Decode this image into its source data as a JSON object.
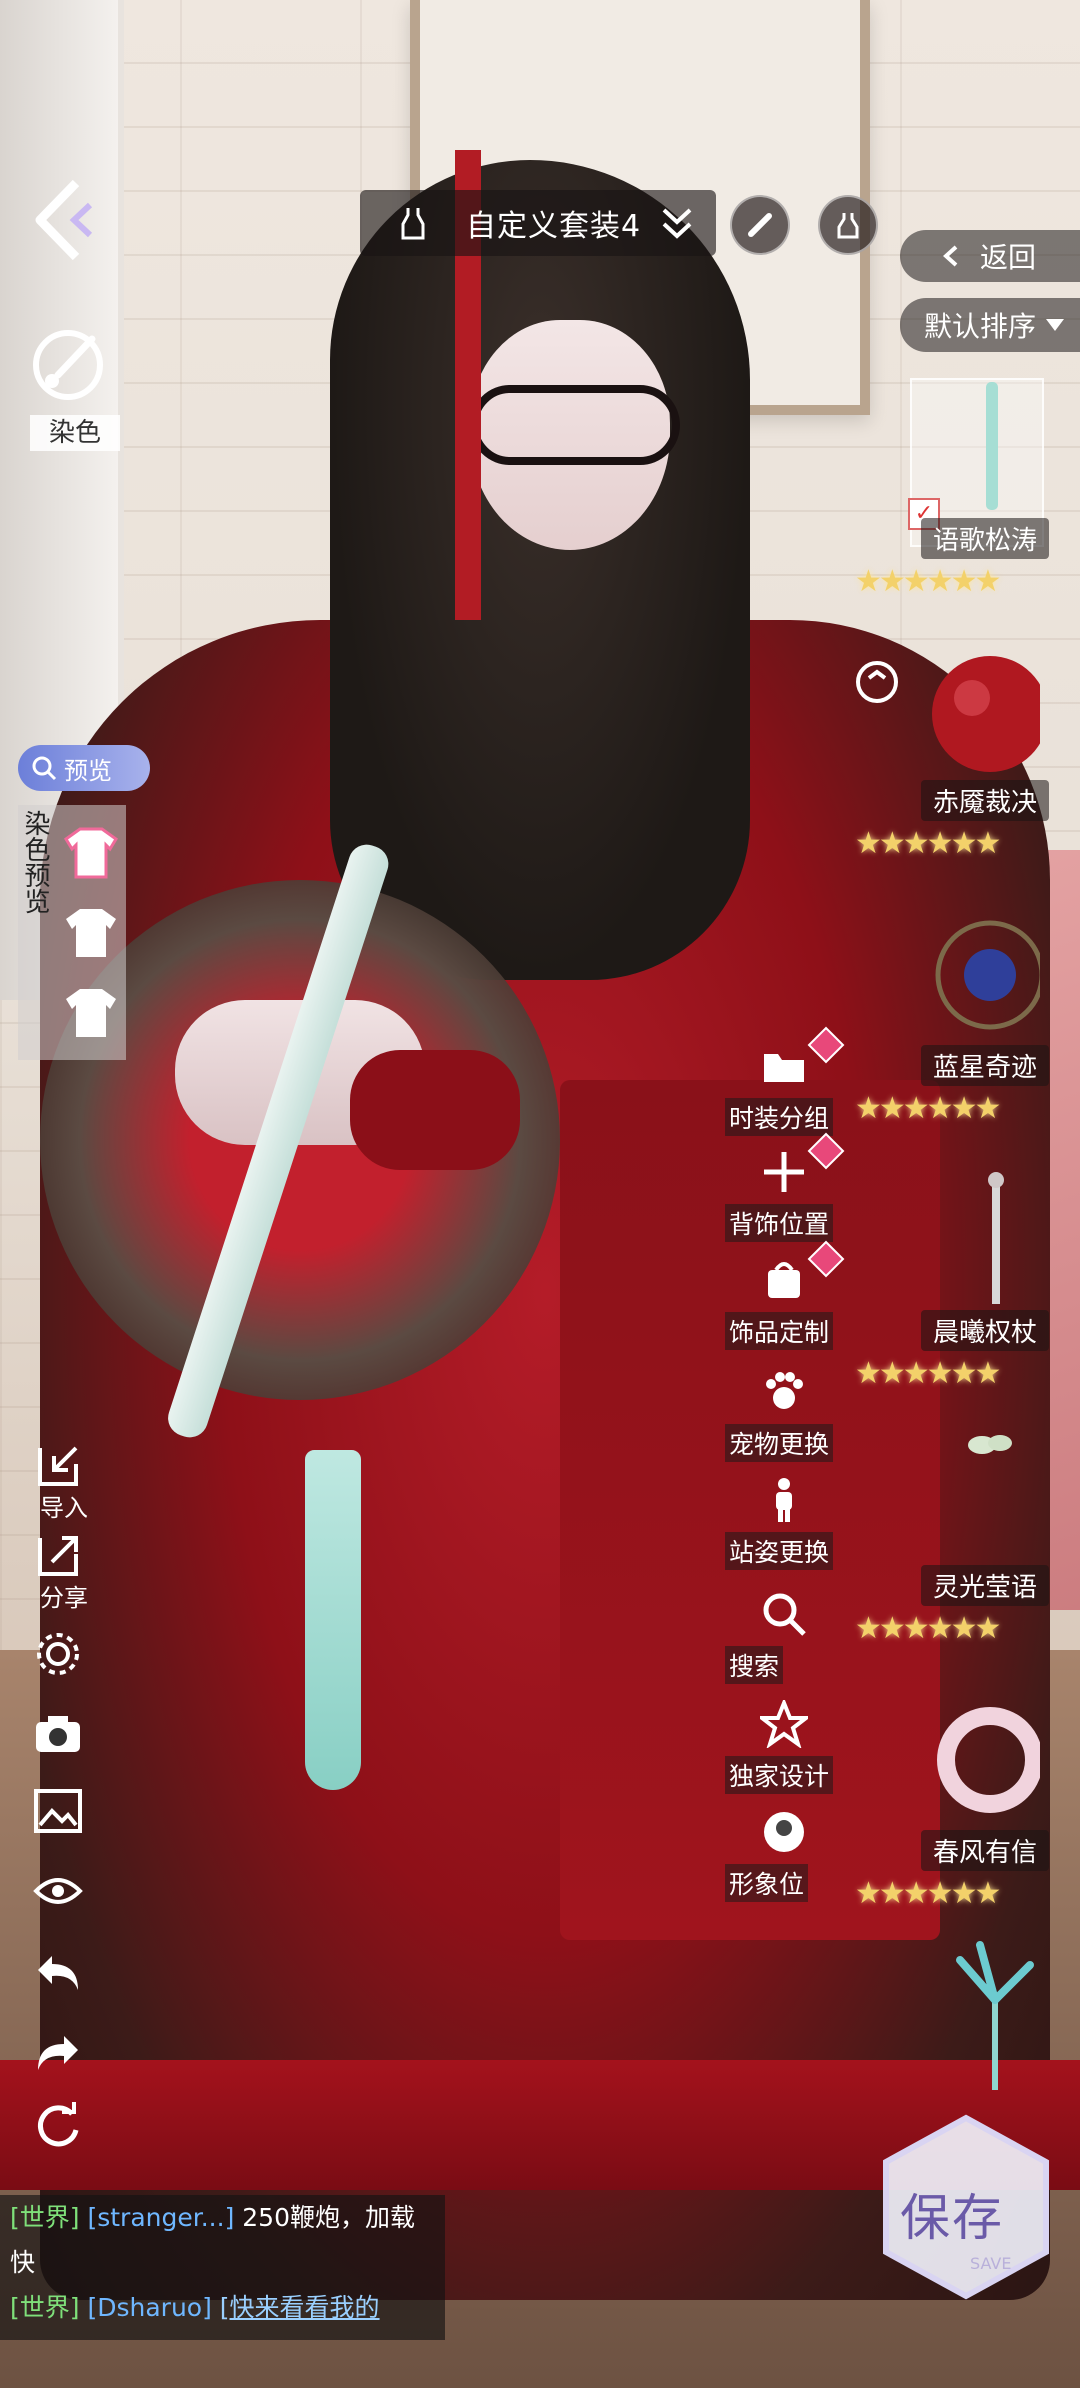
{
  "topbar": {
    "outfit_name": "自定义套装4",
    "icons": [
      "dress-icon",
      "chevron-down-icon",
      "pen-icon",
      "outfit-icon"
    ]
  },
  "left_panel": {
    "dye_label": "染色",
    "preview_tag": "预览",
    "dye_preview_label": "染色预览"
  },
  "right_panel": {
    "return_label": "返回",
    "sort_label": "默认排序",
    "items": [
      {
        "name": "语歌松涛",
        "stars": 6,
        "selected": true
      },
      {
        "name": "赤魇裁决",
        "stars": 6,
        "selected": false
      },
      {
        "name": "蓝星奇迹",
        "stars": 6,
        "selected": false
      },
      {
        "name": "晨曦权杖",
        "stars": 6,
        "selected": false
      },
      {
        "name": "灵光莹语",
        "stars": 6,
        "selected": false
      },
      {
        "name": "春风有信",
        "stars": 6,
        "selected": false
      }
    ]
  },
  "menu": {
    "items": [
      "时装分组",
      "背饰位置",
      "饰品定制",
      "宠物更换",
      "站姿更换",
      "搜索",
      "独家设计",
      "形象位"
    ]
  },
  "tools": {
    "import_label": "导入",
    "share_label": "分享"
  },
  "chat": {
    "line1": {
      "channel": "[世界]",
      "user": "[stranger...]",
      "text": "250鞭炮，加载快"
    },
    "line2": {
      "channel": "[世界]",
      "user": "[Dsharuo]",
      "text": "[快来看看我的"
    }
  },
  "save": {
    "label": "保存",
    "sub": "SAVE"
  },
  "colors": {
    "accent": "#e8487a",
    "star": "#f3d16a",
    "chat_channel": "#7fe07a",
    "chat_user": "#6fb7ff"
  }
}
